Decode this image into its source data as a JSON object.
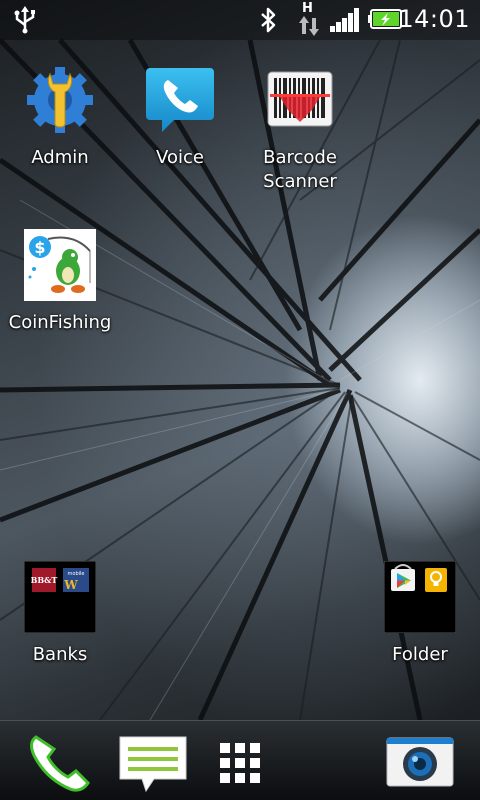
{
  "status_bar": {
    "time": "14:01",
    "network_type": "H",
    "icons": [
      "usb-icon",
      "bluetooth-icon",
      "data-arrows-icon",
      "signal-icon",
      "battery-charging-icon"
    ]
  },
  "apps": [
    {
      "label": "Admin",
      "icon": "admin-wrench-gear-icon"
    },
    {
      "label": "Voice",
      "icon": "voice-phone-bubble-icon"
    },
    {
      "label": "Barcode\nScanner",
      "label_line1": "Barcode",
      "label_line2": "Scanner",
      "icon": "barcode-scanner-icon"
    },
    {
      "label": "CoinFishing",
      "icon": "coinfishing-icon"
    },
    {
      "label": "Banks",
      "icon": "banks-folder-icon",
      "folder_items": [
        "BB&T",
        "mobile W"
      ]
    },
    {
      "label": "Folder",
      "icon": "folder-icon",
      "folder_items": [
        "play-store-icon",
        "keep-bulb-icon"
      ]
    }
  ],
  "dock": [
    {
      "name": "phone",
      "icon": "phone-handset-icon"
    },
    {
      "name": "messages",
      "icon": "message-bubble-icon"
    },
    {
      "name": "all-apps",
      "icon": "app-grid-icon"
    },
    {
      "name": "camera",
      "icon": "camera-icon"
    }
  ],
  "colors": {
    "battery_green": "#5fd42a",
    "voice_blue": "#1fa3e0",
    "admin_blue": "#2f7fd6",
    "admin_yellow": "#f2c230",
    "scanner_red": "#e0202a",
    "phone_green": "#3fbf2a"
  }
}
